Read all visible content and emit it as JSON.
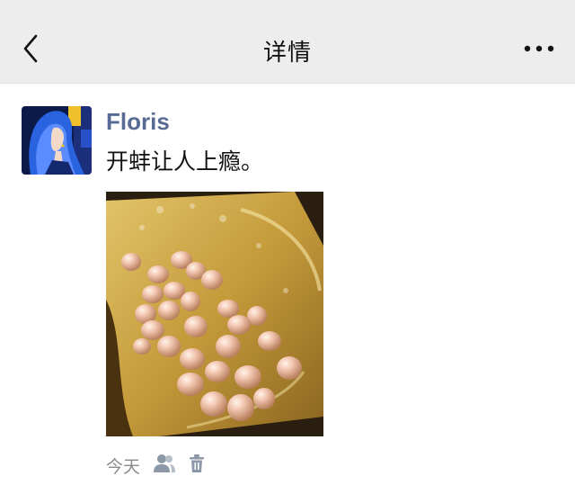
{
  "header": {
    "title": "详情",
    "back_icon": "chevron-left-icon",
    "more_icon": "more-dots-icon"
  },
  "post": {
    "author": "Floris",
    "text": "开蚌让人上瘾。",
    "time": "今天",
    "footer_icons": [
      "visibility-people-icon",
      "trash-icon"
    ]
  },
  "colors": {
    "navbar_bg": "#ededed",
    "author_name": "#576b95",
    "icon_gray": "#8c97a8"
  }
}
